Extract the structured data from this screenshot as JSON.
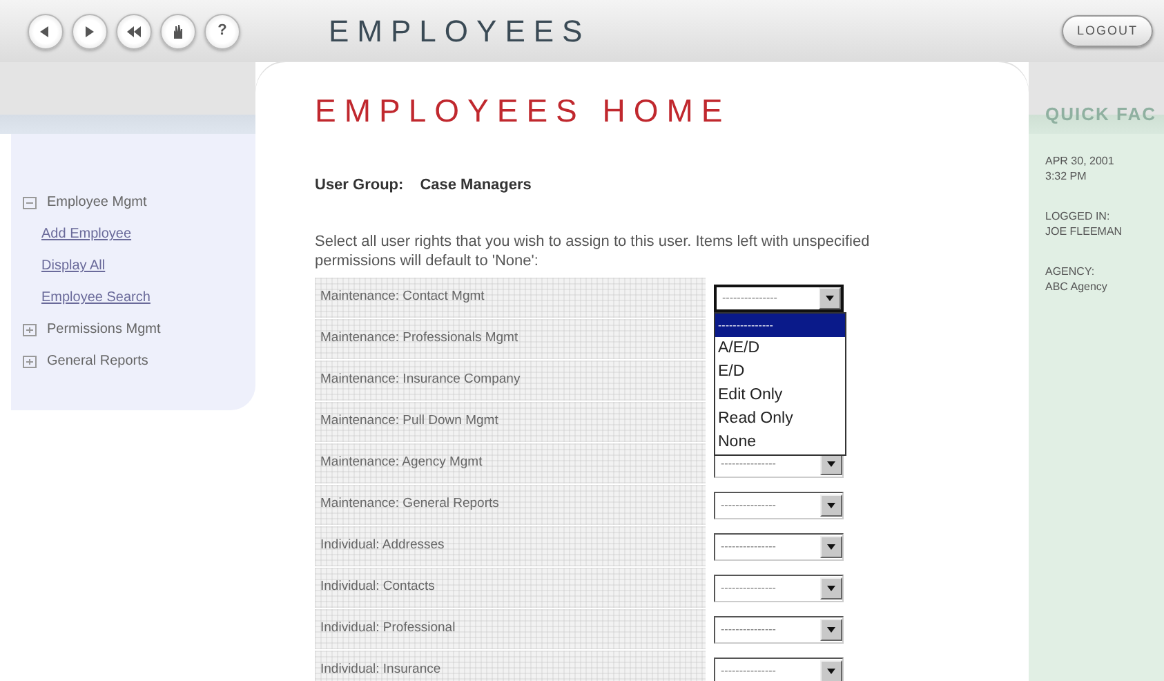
{
  "nav_buttons": [
    {
      "kind": "back"
    },
    {
      "kind": "forward"
    },
    {
      "kind": "rewind"
    },
    {
      "kind": "hand"
    },
    {
      "kind": "help",
      "label": "?"
    }
  ],
  "app_title": "EMPLOYEES",
  "logout_button": "LOGOUT",
  "sidebar": {
    "items": [
      {
        "label": "Employee Mgmt",
        "expanded": true,
        "children": [
          {
            "label": "Add Employee"
          },
          {
            "label": "Display All"
          },
          {
            "label": "Employee Search"
          }
        ]
      },
      {
        "label": "Permissions Mgmt",
        "expanded": false
      },
      {
        "label": "General Reports",
        "expanded": false
      }
    ]
  },
  "page_title": "EMPLOYEES HOME",
  "user_group": {
    "label": "User Group:",
    "value": "Case Managers"
  },
  "instructions": "Select all user rights that you wish to assign to this user. Items left with unspecified permissions will default to 'None':",
  "permissions": [
    {
      "label": "Maintenance: Contact Mgmt",
      "value": "---------------",
      "expanded": true,
      "options": [
        {
          "label": "---------------",
          "selected": true
        },
        {
          "label": "A/E/D",
          "selected": false
        },
        {
          "label": "E/D",
          "selected": false
        },
        {
          "label": "Edit Only",
          "selected": false
        },
        {
          "label": "Read Only",
          "selected": false
        },
        {
          "label": "None",
          "selected": false
        }
      ]
    },
    {
      "label": "Maintenance: Professionals Mgmt"
    },
    {
      "label": "Maintenance: Insurance Company"
    },
    {
      "label": "Maintenance: Pull Down Mgmt"
    },
    {
      "label": "Maintenance: Agency Mgmt",
      "value": "---------------",
      "expanded": false
    },
    {
      "label": "Maintenance: General Reports",
      "value": "---------------",
      "expanded": false
    },
    {
      "label": "Individual: Addresses",
      "value": "---------------",
      "expanded": false
    },
    {
      "label": "Individual: Contacts",
      "value": "---------------",
      "expanded": false
    },
    {
      "label": "Individual: Professional",
      "value": "---------------",
      "expanded": false
    },
    {
      "label": "Individual: Insurance",
      "value": "---------------",
      "expanded": false
    }
  ],
  "quick_facts": {
    "title": "QUICK FAC",
    "facts": [
      [
        "APR 30, 2001",
        "3:32 PM"
      ],
      [
        "LOGGED IN:",
        "JOE FLEEMAN"
      ],
      [
        "AGENCY:",
        "ABC Agency"
      ]
    ]
  }
}
